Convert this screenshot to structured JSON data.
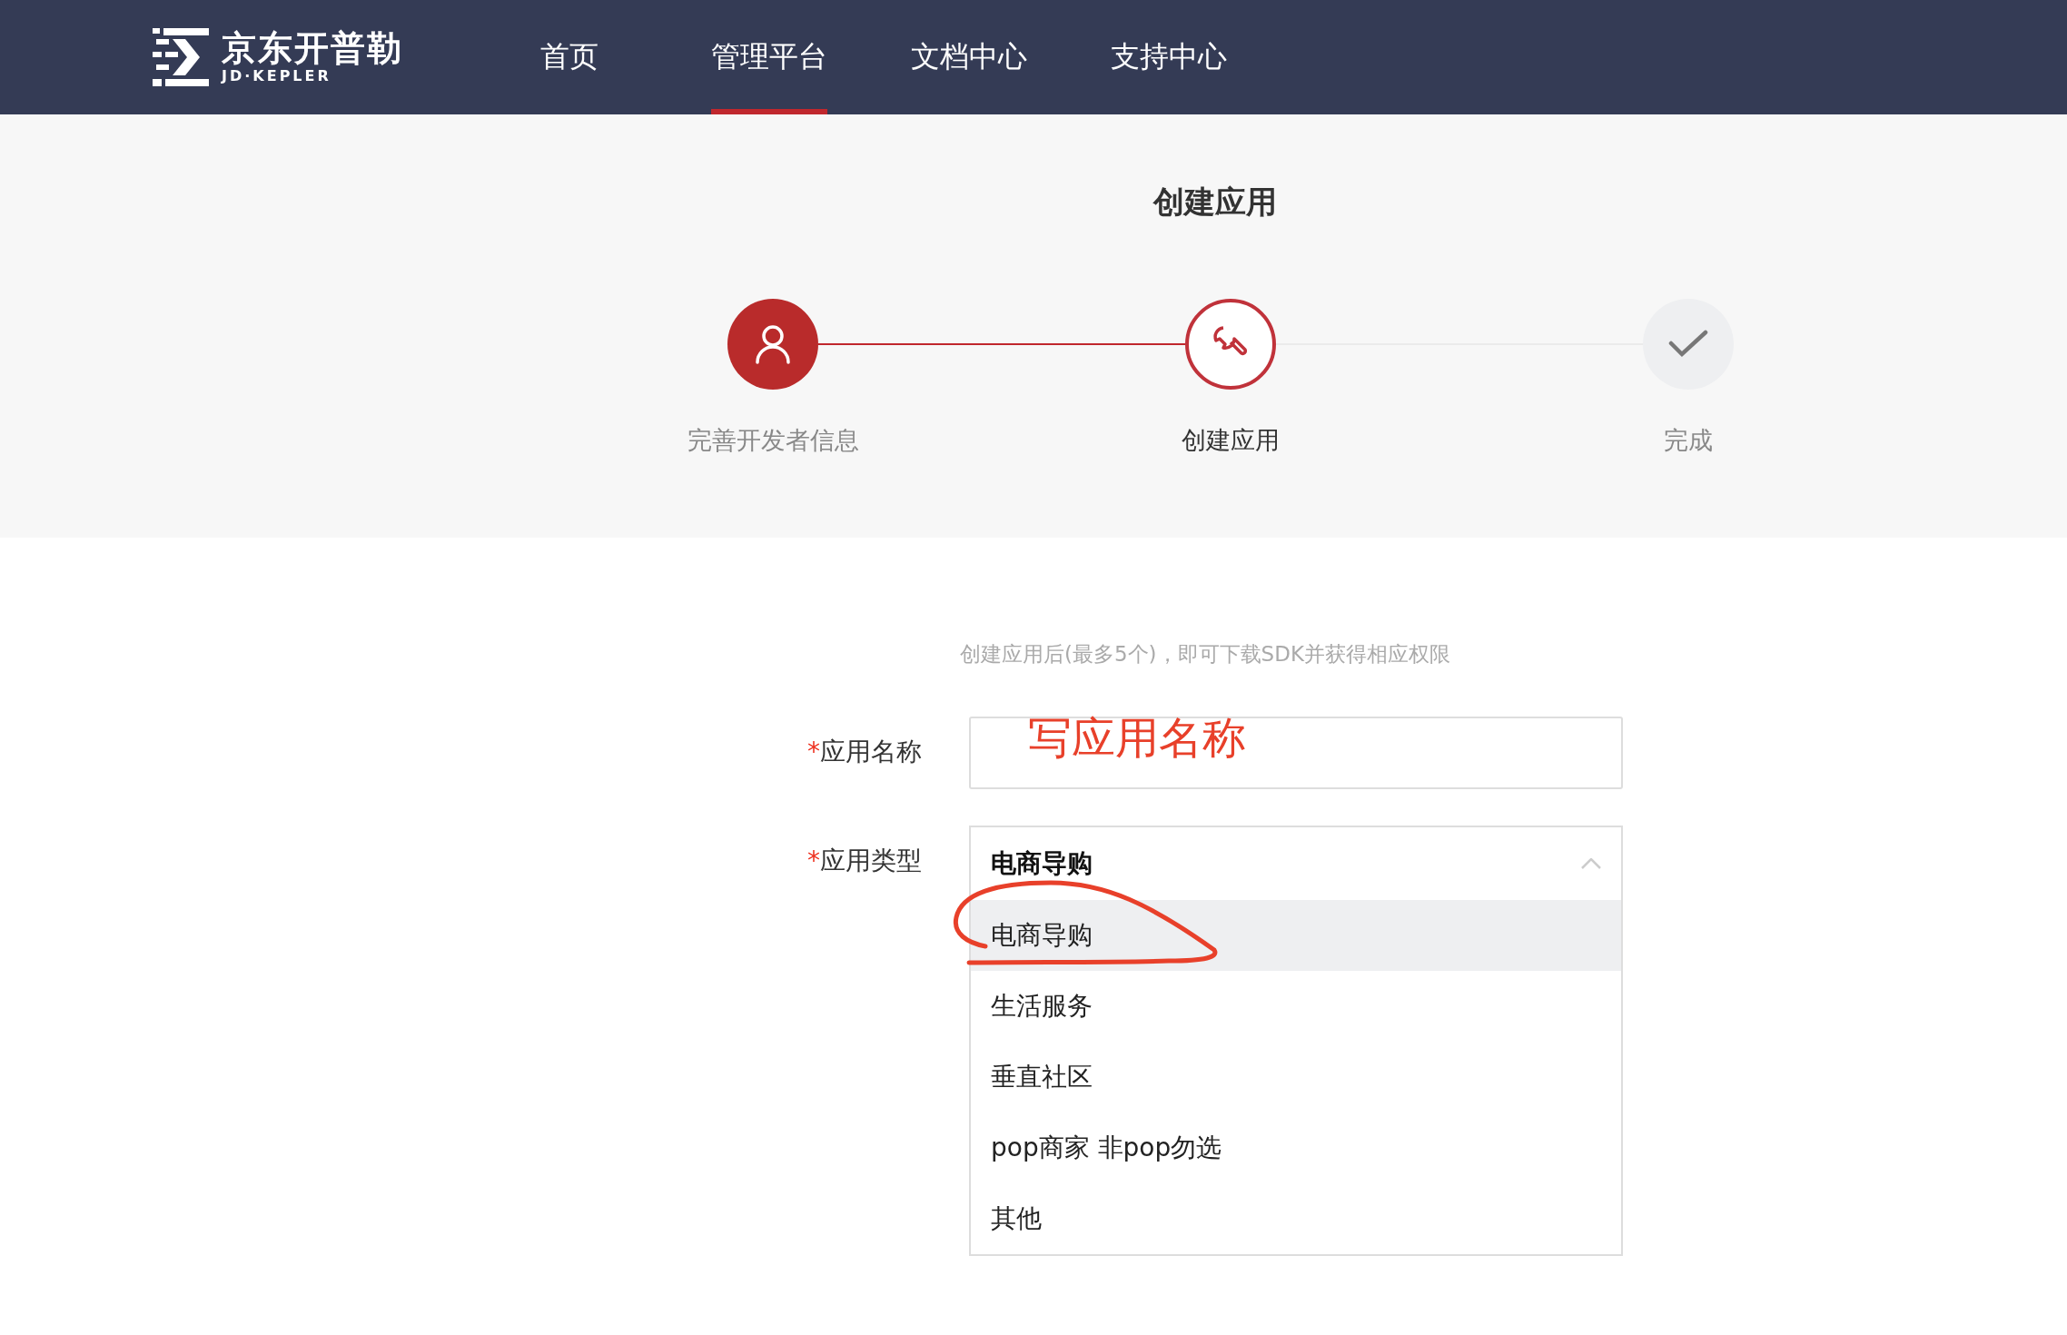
{
  "header": {
    "logo": {
      "name": "京东开普勒",
      "subtitle": "JD·KEPLER"
    },
    "nav": [
      {
        "label": "首页",
        "selected": false
      },
      {
        "label": "管理平台",
        "selected": true
      },
      {
        "label": "文档中心",
        "selected": false
      },
      {
        "label": "支持中心",
        "selected": false
      }
    ]
  },
  "page_title": "创建应用",
  "steps": [
    {
      "label": "完善开发者信息",
      "completed": true,
      "selected": false,
      "kind": "user"
    },
    {
      "label": "创建应用",
      "completed": false,
      "selected": true,
      "kind": "wrench"
    },
    {
      "label": "完成",
      "completed": false,
      "selected": false,
      "kind": "check"
    }
  ],
  "form": {
    "hint": "创建应用后(最多5个)，即可下载SDK并获得相应权限",
    "fields": [
      {
        "kind": "text",
        "required_mark": "*",
        "label": "应用名称",
        "annotation": "写应用名称"
      },
      {
        "kind": "select",
        "required_mark": "*",
        "label": "应用类型",
        "value": "电商导购",
        "expanded": true,
        "options": [
          {
            "label": "电商导购",
            "selected": true
          },
          {
            "label": "生活服务",
            "selected": false
          },
          {
            "label": "垂直社区",
            "selected": false
          },
          {
            "label": "pop商家 非pop勿选",
            "selected": false
          },
          {
            "label": "其他",
            "selected": false
          }
        ]
      }
    ]
  }
}
